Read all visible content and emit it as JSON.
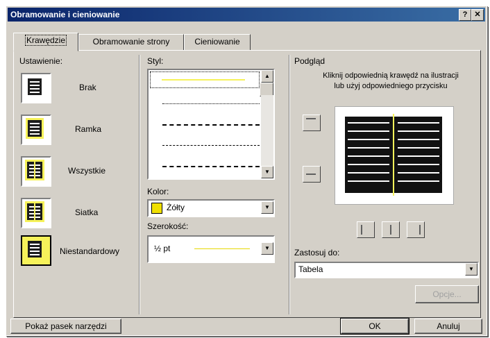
{
  "window": {
    "title": "Obramowanie i cieniowanie",
    "help_label": "?",
    "close_label": "✕"
  },
  "tabs": [
    {
      "label": "Krawędzie",
      "active": true
    },
    {
      "label": "Obramowanie strony",
      "active": false
    },
    {
      "label": "Cieniowanie",
      "active": false
    }
  ],
  "setting": {
    "label": "Ustawienie:",
    "options": [
      {
        "label": "Brak",
        "icon": "setting-none-icon"
      },
      {
        "label": "Ramka",
        "icon": "setting-box-icon"
      },
      {
        "label": "Wszystkie",
        "icon": "setting-all-icon"
      },
      {
        "label": "Siatka",
        "icon": "setting-grid-icon"
      },
      {
        "label": "Niestandardowy",
        "icon": "setting-custom-icon",
        "selected": true
      }
    ]
  },
  "style": {
    "label": "Styl:",
    "selected_index": 0
  },
  "color": {
    "label": "Kolor:",
    "value": "Żółty",
    "swatch": "#f0e000"
  },
  "width": {
    "label": "Szerokość:",
    "value": "½ pt"
  },
  "preview": {
    "label": "Podgląd",
    "hint_line1": "Kliknij odpowiednią krawędź na ilustracji",
    "hint_line2": "lub użyj odpowiedniego przycisku"
  },
  "apply_to": {
    "label": "Zastosuj do:",
    "value": "Tabela"
  },
  "buttons": {
    "options": "Opcje...",
    "toolbar": "Pokaż pasek narzędzi",
    "ok": "OK",
    "cancel": "Anuluj"
  },
  "colors": {
    "title_start": "#0a246a",
    "title_end": "#3a6ea5",
    "face": "#d4d0c8",
    "accent_yellow": "#f6f25a"
  }
}
